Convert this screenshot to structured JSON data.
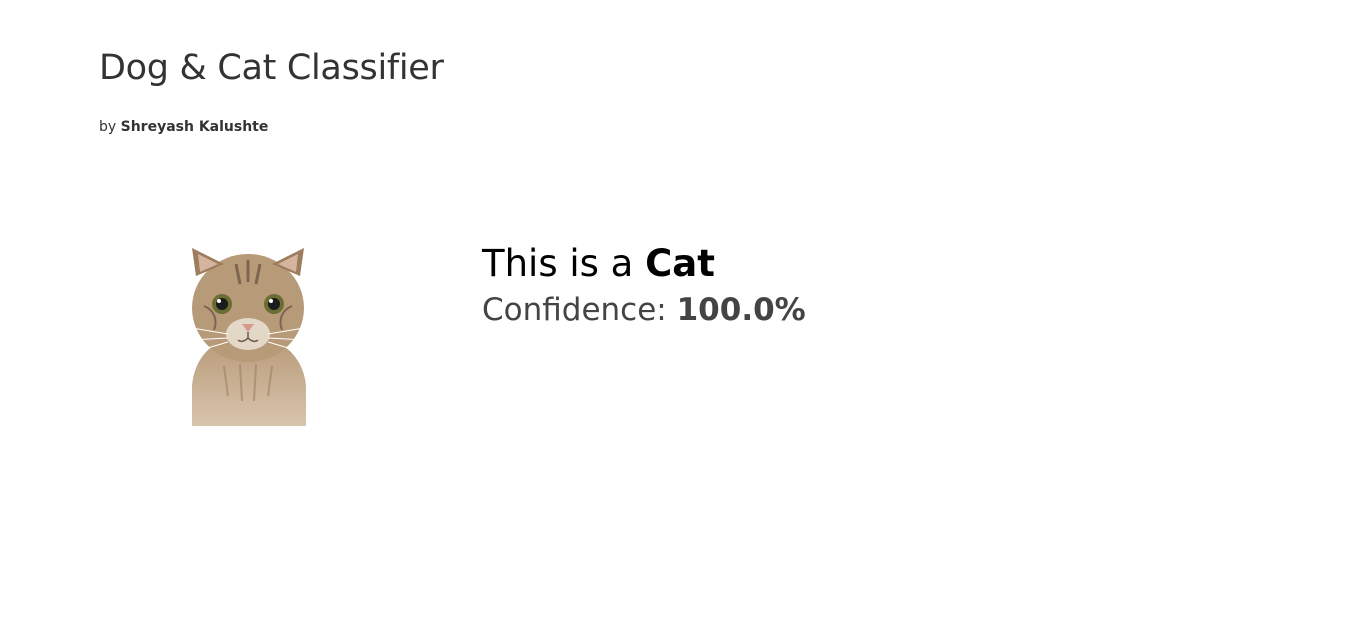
{
  "header": {
    "title": "Dog & Cat Classifier",
    "byline_prefix": "by",
    "author": "Shreyash Kalushte"
  },
  "result": {
    "prefix": "This is a",
    "label": "Cat",
    "confidence_prefix": "Confidence:",
    "confidence_value": "100.0%"
  },
  "image": {
    "subject": "cat-photo",
    "colors": {
      "fur": "#b79a78",
      "fur_dark": "#7d6650",
      "eye": "#6b6d34",
      "nose": "#d79a8d"
    }
  }
}
